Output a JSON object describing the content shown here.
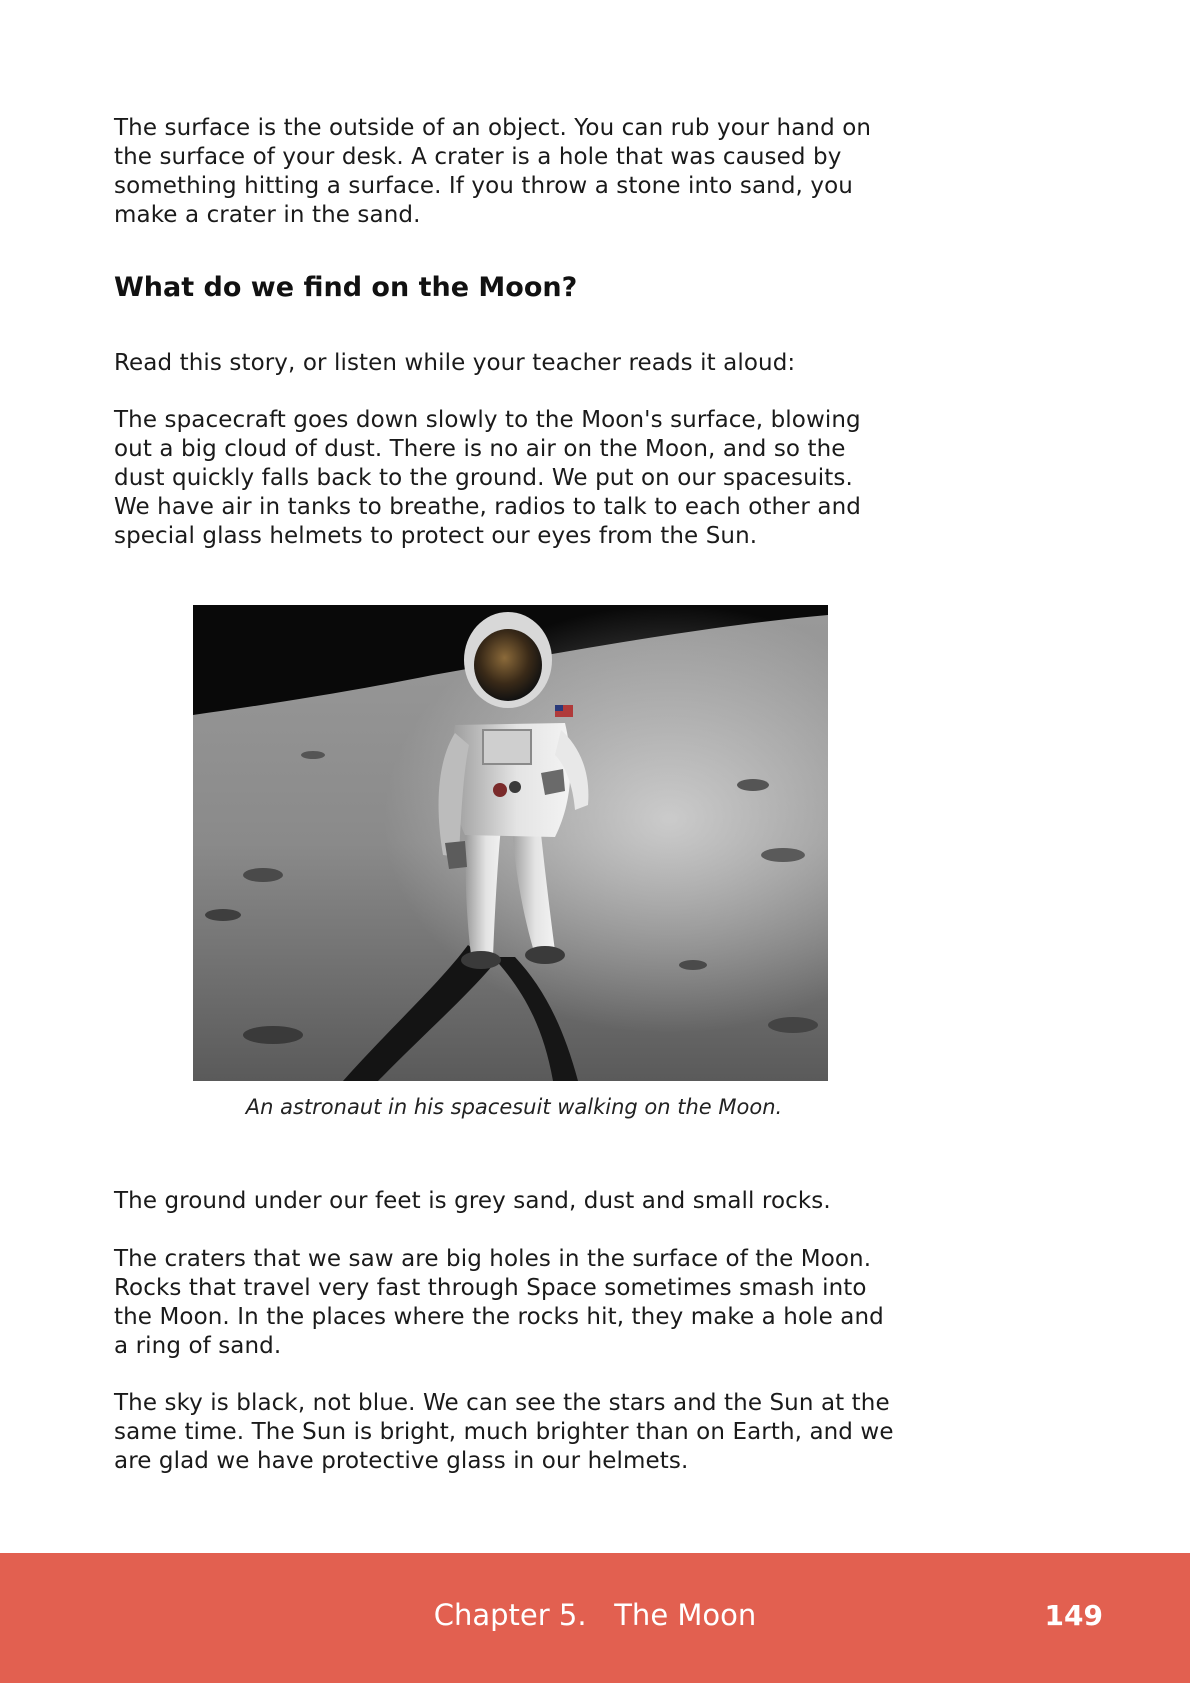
{
  "body": {
    "intro": "The surface is the outside of an object. You can rub your hand on\nthe surface of your desk. A crater is a hole that was caused by\nsomething hitting a surface. If you throw a stone into sand, you\nmake a crater in the sand.",
    "heading": "What do we find on the Moon?",
    "read_prompt": "Read this story, or listen while your teacher reads it aloud:",
    "story_1": "The spacecraft goes down slowly to the Moon's surface, blowing\nout a big cloud of dust. There is no air on the Moon, and so the\ndust quickly falls back to the ground. We put on our spacesuits.\nWe have air in tanks to breathe, radios to talk to each other and\nspecial glass helmets to protect our eyes from the Sun.",
    "caption": "An astronaut in his spacesuit walking on the Moon.",
    "story_2": "The ground under our feet is grey sand, dust and small rocks.",
    "story_3": "The craters that we saw are big holes in the surface of the Moon.\nRocks that travel very fast through Space sometimes smash into\nthe Moon. In the places where the rocks hit, they make a hole and\na ring of sand.",
    "story_4": "The sky is black, not blue. We can see the stars and the Sun at the\nsame time. The Sun is bright, much brighter than on Earth, and we\nare glad we have protective glass in our helmets."
  },
  "footer": {
    "chapter": "Chapter 5.   The Moon",
    "page_number": "149"
  },
  "colors": {
    "footer_band": "#e26050",
    "text": "#1a1a1a"
  }
}
